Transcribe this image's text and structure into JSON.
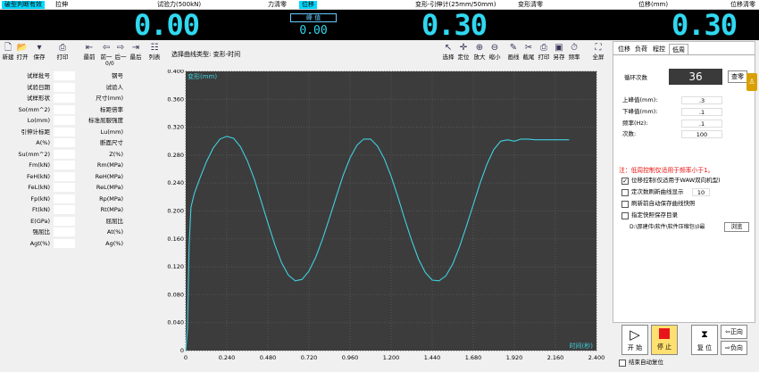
{
  "header": {
    "left_cyan": "破型判断有效",
    "left2": "拉伸",
    "load_label": "试验力(500kN)",
    "mid_cyan": "位移",
    "force_zero": "力清零",
    "ext_label": "变形-引伸计(25mm/50mm)",
    "def_zero": "变形清零",
    "disp_label": "位移(mm)",
    "disp_zero": "位移清零"
  },
  "lcd": {
    "force": "0.00",
    "peak_label": "峰 值",
    "peak_value": "0.00",
    "deform": "0.30",
    "disp": "0.30"
  },
  "toolbar": {
    "new": "新建",
    "open": "打开",
    "save": "保存",
    "print": "打印",
    "first": "最前",
    "prev": "前一",
    "next": "后一",
    "last": "最后",
    "list": "列表",
    "counter": "0/0",
    "curve_type_label": "选择曲线类型:",
    "curve_type_value": "变形-时间",
    "select": "选择",
    "locate": "定位",
    "zoom_in": "放大",
    "zoom_out": "缩小",
    "draw_line": "画线",
    "crop": "截尾",
    "print2": "打印",
    "save_as": "另存",
    "freq": "频率",
    "fullscreen": "全屏"
  },
  "grid": [
    {
      "l": "试样批号",
      "r": "钢号"
    },
    {
      "l": "试验日期",
      "r": "试验人"
    },
    {
      "l": "试样形状",
      "r": "尺寸(mm)"
    },
    {
      "l": "So(mm^2)",
      "r": "标距倍率"
    },
    {
      "l": "Lo(mm)",
      "r": "标准屈服强度"
    },
    {
      "l": "引伸计标距",
      "r": "Lu(mm)"
    },
    {
      "l": "A(%)",
      "r": "断面尺寸"
    },
    {
      "l": "Su(mm^2)",
      "r": "Z(%)"
    },
    {
      "l": "Fm(kN)",
      "r": "Rm(MPa)"
    },
    {
      "l": "FeH(kN)",
      "r": "ReH(MPa)"
    },
    {
      "l": "FeL(kN)",
      "r": "ReL(MPa)"
    },
    {
      "l": "Fp(kN)",
      "r": "Rp(MPa)"
    },
    {
      "l": "Ft(kN)",
      "r": "Rt(MPa)"
    },
    {
      "l": "E(GPa)",
      "r": "屈屈比"
    },
    {
      "l": "强屈比",
      "r": "At(%)"
    },
    {
      "l": "Agt(%)",
      "r": "Ag(%)"
    }
  ],
  "right": {
    "tabs": [
      "位移",
      "负荷",
      "程控",
      "低周"
    ],
    "cycles_label": "循环次数",
    "cycles_value": "36",
    "query": "查零",
    "upper_label": "上峰值(mm):",
    "upper": ".3",
    "lower_label": "下峰值(mm):",
    "lower": ".1",
    "freq_label": "频率(Hz):",
    "freq": ".1",
    "count_label": "次数:",
    "count": "100",
    "note": "注：低周控制仅适用于频率小于1。",
    "opt1": "位移控制(仅适用于WAW双向机型)",
    "opt2": "定次数刷新曲线显示",
    "opt2_val": "10",
    "opt3": "刷新前自动保存曲线快照",
    "opt4": "指定快照保存目录",
    "path": "D:\\那建伟\\软件\\软件压缩包\\0最",
    "browse": "浏览"
  },
  "bottom": {
    "start": "开 始",
    "stop": "停 止",
    "reset": "复 位",
    "fwd": "正向",
    "rev": "负向",
    "auto_reset": "结束自动复位"
  },
  "colors": {
    "cyan": "#00d8ff",
    "lcd": "#30d8f0",
    "curve": "#40d0e0",
    "plotbg": "#3c3c3c",
    "stop": "#e8141c",
    "note": "#e81010"
  },
  "chart_data": {
    "type": "line",
    "ylabel": "变形(mm)",
    "xlabel": "时间(秒)",
    "xlim": [
      0,
      2.4
    ],
    "ylim": [
      0,
      0.4
    ],
    "xticks": [
      "0",
      "0.240",
      "0.480",
      "0.720",
      "0.960",
      "1.200",
      "1.440",
      "1.680",
      "1.920",
      "2.160",
      "2.400"
    ],
    "yticks": [
      "0",
      "0.040",
      "0.080",
      "0.120",
      "0.160",
      "0.200",
      "0.240",
      "0.280",
      "0.320",
      "0.360",
      "0.400"
    ],
    "series": [
      {
        "x": [
          0,
          0.01,
          0.02,
          0.03,
          0.05,
          0.08,
          0.12,
          0.16,
          0.2,
          0.24,
          0.28,
          0.32,
          0.36,
          0.4,
          0.44,
          0.48,
          0.52,
          0.56,
          0.6,
          0.64,
          0.68,
          0.72,
          0.76,
          0.8,
          0.84,
          0.88,
          0.92,
          0.96,
          1.0,
          1.04,
          1.08,
          1.12,
          1.16,
          1.2,
          1.24,
          1.28,
          1.32,
          1.36,
          1.4,
          1.44,
          1.48,
          1.52,
          1.56,
          1.6,
          1.64,
          1.68,
          1.72,
          1.76,
          1.8,
          1.84,
          1.88,
          1.92,
          1.96,
          2.0,
          2.04,
          2.08,
          2.12,
          2.16,
          2.2,
          2.24
        ],
        "y": [
          0,
          0.03,
          0.15,
          0.205,
          0.225,
          0.245,
          0.27,
          0.29,
          0.303,
          0.307,
          0.304,
          0.292,
          0.272,
          0.246,
          0.215,
          0.183,
          0.152,
          0.126,
          0.108,
          0.1,
          0.102,
          0.114,
          0.134,
          0.16,
          0.19,
          0.221,
          0.251,
          0.276,
          0.294,
          0.303,
          0.303,
          0.293,
          0.275,
          0.25,
          0.22,
          0.188,
          0.158,
          0.131,
          0.112,
          0.101,
          0.1,
          0.107,
          0.124,
          0.149,
          0.178,
          0.209,
          0.24,
          0.267,
          0.288,
          0.3,
          0.302,
          0.3,
          0.303,
          0.303,
          0.302,
          0.302,
          0.302,
          0.302,
          0.302,
          0.302
        ]
      }
    ]
  }
}
